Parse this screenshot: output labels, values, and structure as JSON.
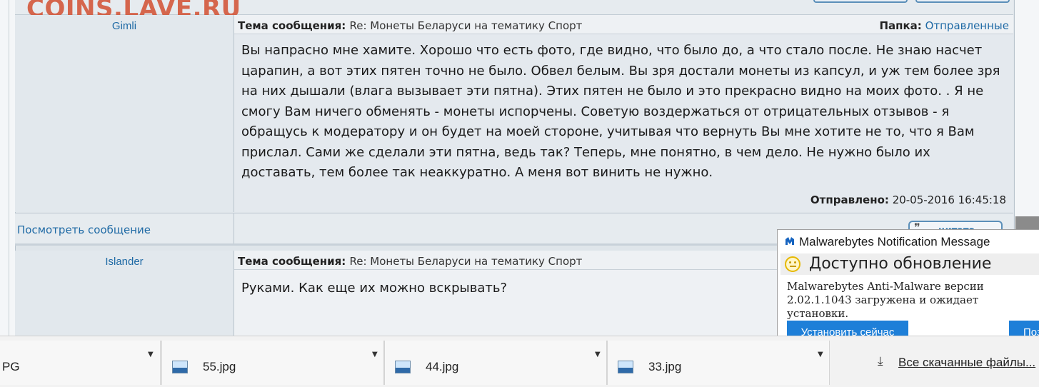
{
  "watermark": "COINS.LAVE.RU",
  "posts": [
    {
      "author": "Gimli",
      "subject_label": "Тема сообщения:",
      "subject": "Re: Монеты Беларуси на тематику Спорт",
      "folder_label": "Папка:",
      "folder": "Отправленные",
      "body": "Вы напрасно мне хамите. Хорошо что есть фото, где видно, что было до, а что стало после. Не знаю насчет царапин, а вот этих пятен точно не было. Обвел белым. Вы зря достали монеты из капсул, и уж тем более зря на них дышали (влага вызывает эти пятна). Этих пятен не было и это прекрасно видно на моих фото. . Я не смогу Вам ничего обменять - монеты испорчены. Советую воздержаться от отрицательных отзывов - я обращусь к модератору и он будет на моей стороне, учитывая что вернуть Вы мне хотите не то, что я Вам прислал. Сами же сделали эти пятна, ведь так? Теперь, мне понятно, в чем дело. Не нужно было их доставать, тем более так неаккуратно. А меня вот винить не нужно.",
      "sent_label": "Отправлено:",
      "sent": "20-05-2016 16:45:18"
    },
    {
      "author": "Islander",
      "subject_label": "Тема сообщения:",
      "subject": "Re: Монеты Беларуси на тематику Спорт",
      "body": "Руками. Как еще их можно вскрывать?"
    }
  ],
  "view_message_link": "Посмотреть сообщение",
  "quote_button": "цитата",
  "malwarebytes": {
    "title": "Malwarebytes Notification Message",
    "heading": "Доступно обновление",
    "description": "Malwarebytes Anti-Malware версии 2.02.1.1043 загружена и ожидает установки.",
    "install_button": "Установить сейчас",
    "later_button": "Поз"
  },
  "downloads": {
    "items": [
      {
        "name": "PG",
        "icon": "image-file-icon"
      },
      {
        "name": "55.jpg",
        "icon": "image-file-icon"
      },
      {
        "name": "44.jpg",
        "icon": "image-file-icon"
      },
      {
        "name": "33.jpg",
        "icon": "image-file-icon"
      }
    ],
    "all_label": "Все скачанные файлы..."
  },
  "colors": {
    "link": "#1f6aa5",
    "watermark": "#d4583c",
    "mb_button": "#1e7fd8",
    "forum_bg": "#dfe5ea"
  }
}
